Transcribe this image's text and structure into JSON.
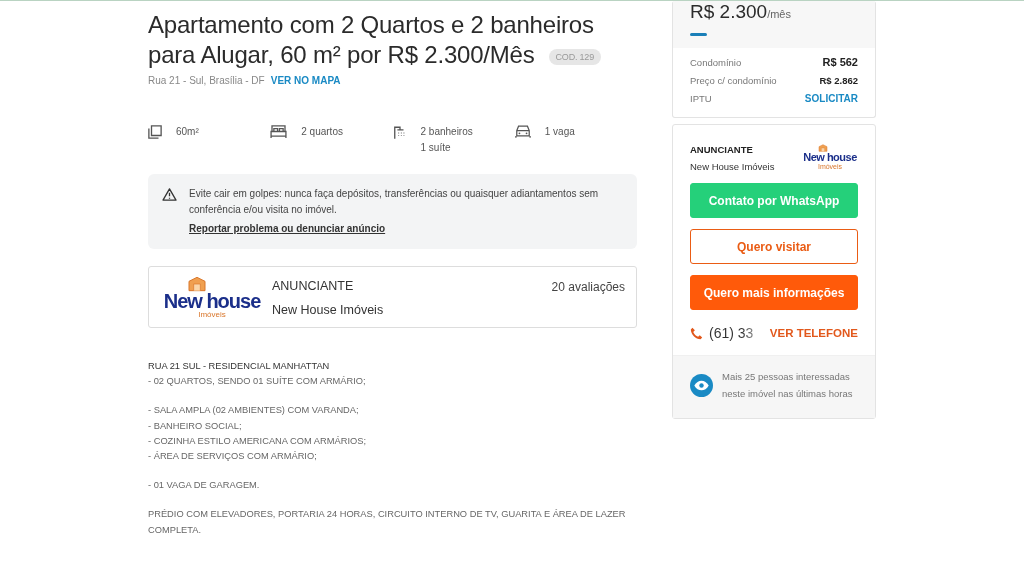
{
  "listing": {
    "title": "Apartamento com 2 Quartos e 2 banheiros para Alugar, 60 m² por R$ 2.300/Mês",
    "code": "COD. 129",
    "address": "Rua 21 - Sul, Brasília - DF",
    "map_link": "VER NO MAPA"
  },
  "features": [
    {
      "kind": "area",
      "lines": [
        "60m²"
      ]
    },
    {
      "kind": "bed",
      "lines": [
        "2 quartos"
      ]
    },
    {
      "kind": "bath",
      "lines": [
        "2 banheiros",
        "1 suíte"
      ]
    },
    {
      "kind": "car",
      "lines": [
        "1 vaga"
      ]
    }
  ],
  "warning": {
    "text": "Evite cair em golpes: nunca faça depósitos, transferências ou quaisquer adiantamentos sem conferência e/ou visita no imóvel.",
    "link": "Reportar problema ou denunciar anúncio"
  },
  "advertiser": {
    "label": "ANUNCIANTE",
    "name": "New House Imóveis",
    "reviews": "20 avaliações",
    "logo": {
      "name": "New house",
      "tagline": "Imóveis"
    }
  },
  "description": [
    [
      "RUA 21 SUL - RESIDENCIAL MANHATTAN",
      "- 02 QUARTOS, SENDO 01 SUÍTE COM ARMÁRIO;"
    ],
    [
      "- SALA AMPLA (02 AMBIENTES) COM VARANDA;",
      "- BANHEIRO SOCIAL;",
      "- COZINHA ESTILO AMERICANA COM ARMÁRIOS;",
      "- ÁREA DE SERVIÇOS COM ARMÁRIO;"
    ],
    [
      "- 01 VAGA DE GARAGEM."
    ],
    [
      "PRÉDIO COM ELEVADORES, PORTARIA 24 HORAS, CIRCUITO INTERNO DE TV, GUARITA E ÁREA DE LAZER COMPLETA."
    ]
  ],
  "price_card": {
    "price": "R$ 2.300",
    "unit": "/mês",
    "rows": [
      {
        "kind": "value",
        "label": "Condomínio",
        "value": "R$ 562"
      },
      {
        "kind": "value",
        "label": "Preço c/ condomínio",
        "value": "R$ 2.862"
      },
      {
        "kind": "link",
        "label": "IPTU",
        "value": "SOLICITAR"
      }
    ]
  },
  "contact_card": {
    "label": "ANUNCIANTE",
    "name": "New House Imóveis",
    "logo": {
      "name": "New house",
      "tagline": "Imóveis"
    },
    "buttons": [
      {
        "kind": "whatsapp",
        "label": "Contato por WhatsApp"
      },
      {
        "kind": "outline",
        "label": "Quero visitar"
      },
      {
        "kind": "solid",
        "label": "Quero mais informações"
      }
    ],
    "phone": "(61) 33",
    "phone_link": "VER TELEFONE",
    "interest": "Mais 25 pessoas interessadas neste imóvel nas últimas horas"
  }
}
